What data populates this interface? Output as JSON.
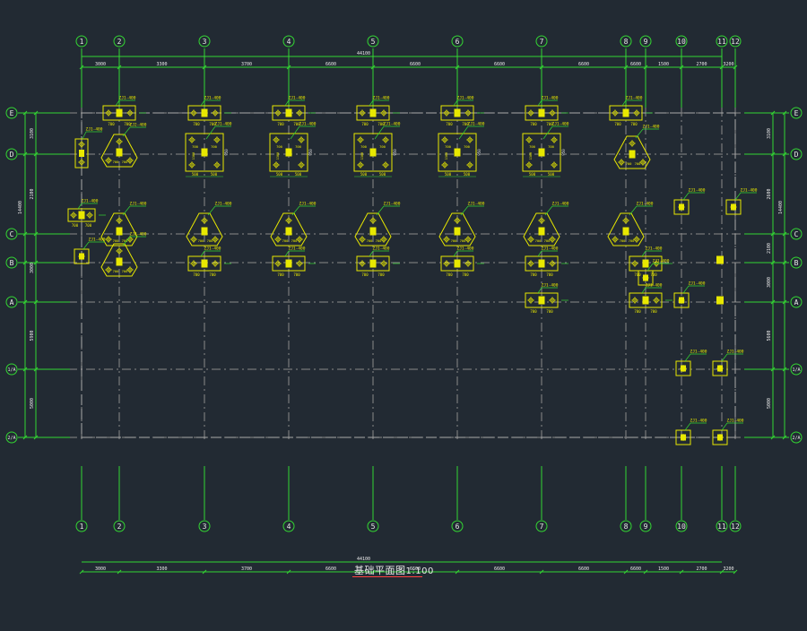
{
  "drawing": {
    "title": "基础平面图",
    "scale": "1:100",
    "colors": {
      "background": "#222a33",
      "axis": "#33d633",
      "grid": "#8a8a8a",
      "footing": "#e8e800",
      "label_white": "#e8e8e8",
      "accent_red": "#ff4040"
    }
  },
  "axes_x": {
    "labels": [
      "1",
      "2",
      "3",
      "4",
      "5",
      "6",
      "7",
      "8",
      "9",
      "10",
      "11",
      "12"
    ],
    "spacings": [
      "3000",
      "3300",
      "3700",
      "6600",
      "6600",
      "6600",
      "6600",
      "6600",
      "1500",
      "2700",
      "3200",
      "1500"
    ],
    "total": "44100"
  },
  "axes_y": {
    "labels": [
      "E",
      "D",
      "C",
      "B",
      "A",
      "1/A",
      "2/A"
    ],
    "left_dims": [
      "3100",
      "2100",
      "3000",
      "5900",
      "5000"
    ],
    "left_total": "14400",
    "right_dims": [
      "3100",
      "2600",
      "2100",
      "3000",
      "5600",
      "5000"
    ],
    "right_total": "14400"
  },
  "footing_label": "ZJ1-400",
  "footing_label_alt": "ZJ2-400",
  "small_dims": [
    "700",
    "700",
    "500",
    "950",
    "1300",
    "600"
  ]
}
